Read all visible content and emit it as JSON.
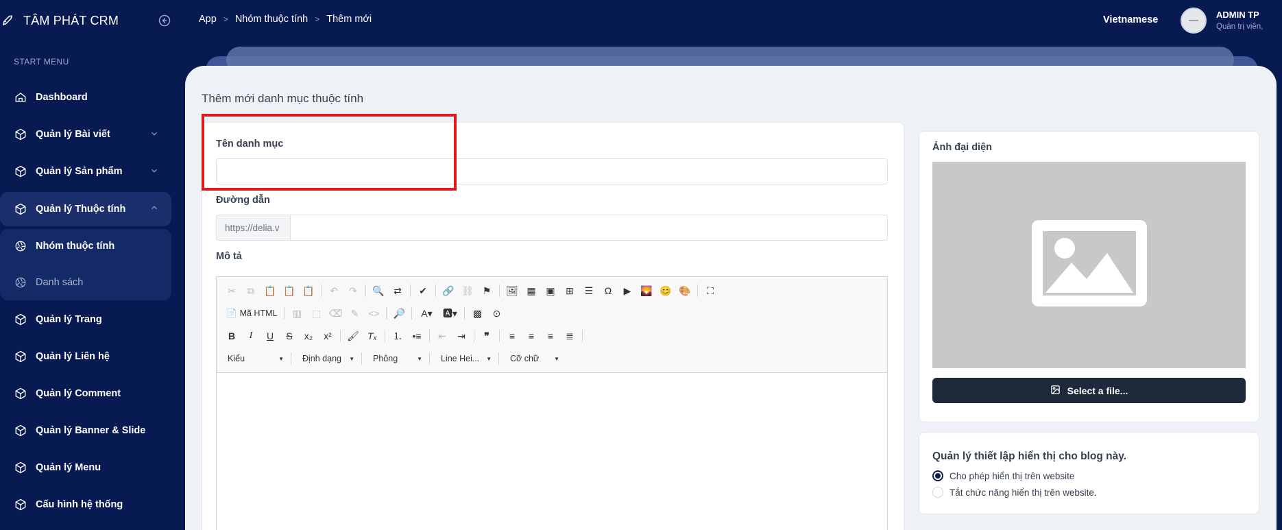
{
  "sidebar": {
    "brand": "TÂM PHÁT CRM",
    "start_menu": "START MENU",
    "items": [
      {
        "label": "Dashboard"
      },
      {
        "label": "Quản lý Bài viết"
      },
      {
        "label": "Quản lý Sản phẩm"
      },
      {
        "label": "Quản lý Thuộc tính"
      },
      {
        "label": "Quản lý Trang"
      },
      {
        "label": "Quản lý Liên hệ"
      },
      {
        "label": "Quản lý Comment"
      },
      {
        "label": "Quản lý Banner & Slide"
      },
      {
        "label": "Quản lý Menu"
      },
      {
        "label": "Cấu hình hệ thống"
      }
    ],
    "submenu": [
      {
        "label": "Nhóm thuộc tính"
      },
      {
        "label": "Danh sách"
      }
    ]
  },
  "header": {
    "breadcrumb": [
      "App",
      "Nhóm thuộc tính",
      "Thêm mới"
    ],
    "language": "Vietnamese",
    "user_name": "ADMIN TP",
    "user_role": "Quản trị viên,"
  },
  "page": {
    "title": "Thêm mới danh mục thuộc tính"
  },
  "form": {
    "name_label": "Tên danh mục",
    "name_value": "",
    "slug_label": "Đường dẫn",
    "slug_prefix": "https://delia.v",
    "slug_value": "",
    "description_label": "Mô tả"
  },
  "editor": {
    "source_label": "Mã HTML",
    "style_combo": "Kiểu",
    "format_combo": "Định dạng",
    "font_combo": "Phông",
    "lineheight_combo": "Line Hei...",
    "size_combo": "Cỡ chữ"
  },
  "image_panel": {
    "title": "Ảnh đại diện",
    "button": "Select a file..."
  },
  "visibility": {
    "title": "Quản lý thiết lập hiển thị cho blog này.",
    "options": [
      {
        "label": "Cho phép hiển thị trên website",
        "selected": true
      },
      {
        "label": "Tắt chức năng hiển thị trên website.",
        "selected": false
      }
    ]
  },
  "colors": {
    "sidebar_bg": "#071a52",
    "accent_dark": "#1e293b",
    "highlight": "#dc1c1c"
  }
}
